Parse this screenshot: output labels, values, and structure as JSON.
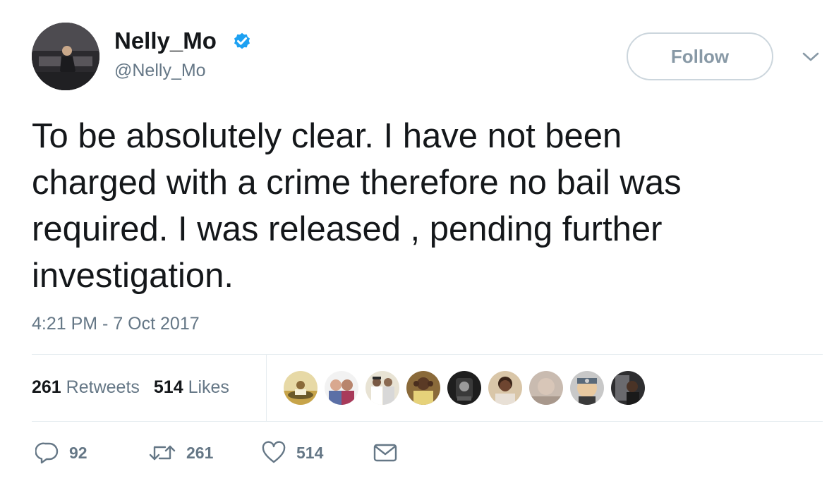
{
  "user": {
    "display_name": "Nelly_Mo",
    "handle": "@Nelly_Mo",
    "verified": true
  },
  "header": {
    "follow_label": "Follow"
  },
  "tweet": {
    "text": "To be absolutely clear. I have not been\ncharged with a crime therefore no bail was\nrequired. I was released , pending further\ninvestigation.",
    "timestamp": "4:21 PM - 7 Oct 2017"
  },
  "stats": {
    "retweets_count": "261",
    "retweets_label": "Retweets",
    "likes_count": "514",
    "likes_label": "Likes"
  },
  "actions": {
    "reply_count": "92",
    "retweet_count": "261",
    "like_count": "514"
  },
  "icons": {
    "verified": "verified-badge-icon",
    "caret": "chevron-down-icon",
    "reply": "reply-icon",
    "retweet": "retweet-icon",
    "like": "heart-icon",
    "dm": "envelope-icon"
  },
  "colors": {
    "text_primary": "#14171a",
    "text_secondary": "#657786",
    "verified_blue": "#1da1f2",
    "border": "#ccd6dd",
    "follow_text": "#8899a6",
    "divider": "#e6ecf0"
  }
}
